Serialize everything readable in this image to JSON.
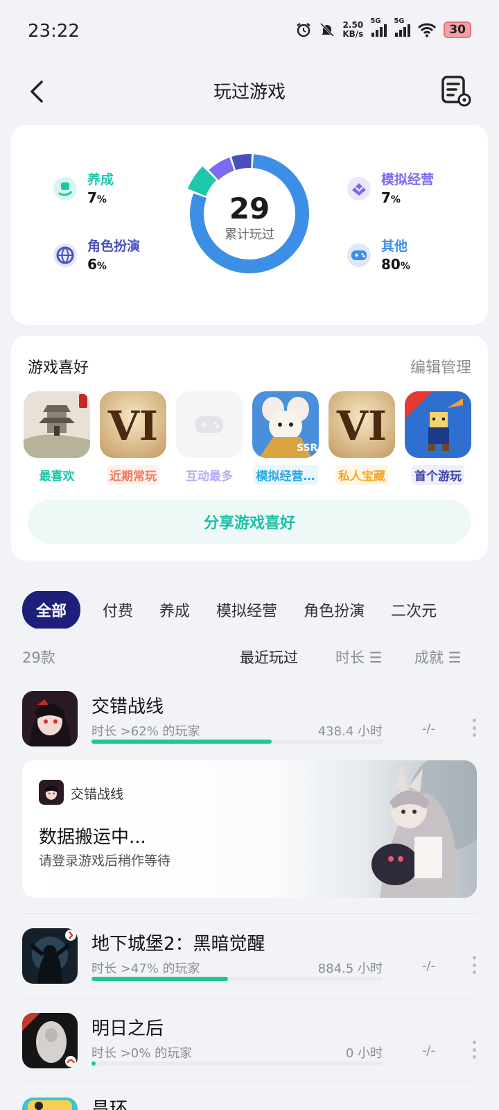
{
  "status_bar": {
    "time": "23:22",
    "net_speed": "2.50",
    "net_unit": "KB/s",
    "sim1": "5G",
    "sim2": "5G",
    "battery": "30"
  },
  "header": {
    "title": "玩过游戏"
  },
  "stats": {
    "total": "29",
    "total_label": "累计玩过",
    "categories": [
      {
        "label": "养成",
        "value": "7",
        "unit": "%",
        "color": "#1cc7ac"
      },
      {
        "label": "角色扮演",
        "value": "6",
        "unit": "%",
        "color": "#4a4fc0"
      },
      {
        "label": "模拟经营",
        "value": "7",
        "unit": "%",
        "color": "#7b6bf0"
      },
      {
        "label": "其他",
        "value": "80",
        "unit": "%",
        "color": "#3d8ee6"
      }
    ]
  },
  "preferences": {
    "title": "游戏喜好",
    "edit": "编辑管理",
    "items": [
      {
        "tag": "最喜欢",
        "color": "#1cc7ac",
        "bg": "#ffffff"
      },
      {
        "tag": "近期常玩",
        "color": "#f07a5a",
        "bg": "#fff2ed"
      },
      {
        "tag": "互动最多",
        "color": "#b6aef4",
        "bg": "#f6f4ff"
      },
      {
        "tag": "模拟经营…",
        "color": "#29a8e6",
        "bg": "#eaf6fd"
      },
      {
        "tag": "私人宝藏",
        "color": "#f5a623",
        "bg": "#fff6e6"
      },
      {
        "tag": "首个游玩",
        "color": "#3a3fa6",
        "bg": "#eeeffa"
      }
    ],
    "share": "分享游戏喜好"
  },
  "tabs": [
    "全部",
    "付费",
    "养成",
    "模拟经营",
    "角色扮演",
    "二次元"
  ],
  "list_header": {
    "count": "29款",
    "sort_recent": "最近玩过",
    "sort_time": "时长 ☰",
    "sort_achievement": "成就 ☰"
  },
  "games": [
    {
      "name": "交错战线",
      "sub": "时长 >62% 的玩家",
      "hours": "438.4 小时",
      "achievement": "-/-",
      "progress": 0.62
    },
    {
      "name": "地下城堡2：黑暗觉醒",
      "sub": "时长 >47% 的玩家",
      "hours": "884.5 小时",
      "achievement": "-/-",
      "progress": 0.47
    },
    {
      "name": "明日之后",
      "sub": "时长 >0% 的玩家",
      "hours": "0 小时",
      "achievement": "-/-",
      "progress": 0.0
    },
    {
      "name": "昌环",
      "sub": "",
      "hours": "",
      "achievement": "",
      "progress": 0
    }
  ],
  "banner": {
    "game": "交错战线",
    "title": "数据搬运中...",
    "subtitle": "请登录游戏后稍作等待"
  }
}
